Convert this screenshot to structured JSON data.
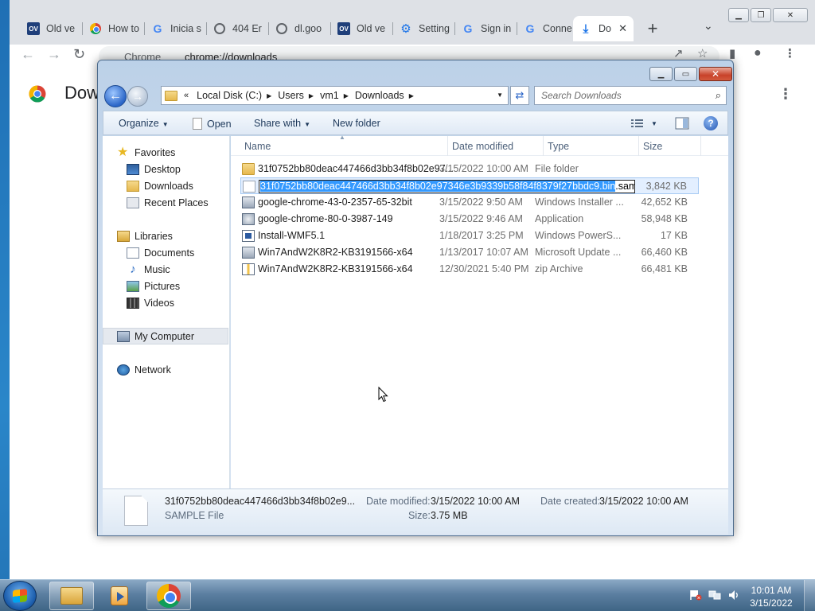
{
  "browser": {
    "tabs": [
      {
        "title": "Old ve",
        "icon": "ov-favicon"
      },
      {
        "title": "How to",
        "icon": "chrome-favicon"
      },
      {
        "title": "Inicia s",
        "icon": "google-favicon"
      },
      {
        "title": "404 Er",
        "icon": "globe-favicon"
      },
      {
        "title": "dl.goo",
        "icon": "globe-favicon"
      },
      {
        "title": "Old ve",
        "icon": "ov-favicon"
      },
      {
        "title": "Setting",
        "icon": "gear-favicon"
      },
      {
        "title": "Sign in",
        "icon": "google-favicon"
      },
      {
        "title": "Conne",
        "icon": "google-favicon"
      },
      {
        "title": "Do",
        "icon": "download-favicon",
        "active": true
      }
    ],
    "omnibox": {
      "site_label": "Chrome",
      "url": "chrome://downloads"
    },
    "page_title": "Dow"
  },
  "explorer": {
    "breadcrumb": [
      "Local Disk (C:)",
      "Users",
      "vm1",
      "Downloads"
    ],
    "search_placeholder": "Search Downloads",
    "commands": {
      "organize": "Organize",
      "open": "Open",
      "share_with": "Share with",
      "new_folder": "New folder"
    },
    "nav": {
      "favorites": "Favorites",
      "desktop": "Desktop",
      "downloads": "Downloads",
      "recent_places": "Recent Places",
      "libraries": "Libraries",
      "documents": "Documents",
      "music": "Music",
      "pictures": "Pictures",
      "videos": "Videos",
      "my_computer": "My Computer",
      "network": "Network"
    },
    "columns": {
      "name": "Name",
      "date": "Date modified",
      "type": "Type",
      "size": "Size"
    },
    "files": [
      {
        "name": "31f0752bb80deac447466d3bb34f8b02e97...",
        "date": "3/15/2022 10:00 AM",
        "type": "File folder",
        "size": "",
        "icon": "folder-icon"
      },
      {
        "name": "",
        "date": "",
        "type": "",
        "size": "3,842 KB",
        "icon": "file-icon",
        "renaming": true
      },
      {
        "name": "google-chrome-43-0-2357-65-32bit",
        "date": "3/15/2022 9:50 AM",
        "type": "Windows Installer ...",
        "size": "42,652 KB",
        "icon": "msi-icon"
      },
      {
        "name": "google-chrome-80-0-3987-149",
        "date": "3/15/2022 9:46 AM",
        "type": "Application",
        "size": "58,948 KB",
        "icon": "exe-icon"
      },
      {
        "name": "Install-WMF5.1",
        "date": "1/18/2017 3:25 PM",
        "type": "Windows PowerS...",
        "size": "17 KB",
        "icon": "powershell-icon"
      },
      {
        "name": "Win7AndW2K8R2-KB3191566-x64",
        "date": "1/13/2017 10:07 AM",
        "type": "Microsoft Update ...",
        "size": "66,460 KB",
        "icon": "msu-icon"
      },
      {
        "name": "Win7AndW2K8R2-KB3191566-x64",
        "date": "12/30/2021 5:40 PM",
        "type": "zip Archive",
        "size": "66,481 KB",
        "icon": "zip-icon"
      }
    ],
    "rename": {
      "selected": "31f0752bb80deac447466d3bb34f8b02e97346e3b9339b58f84f8379f27bbdc9.bin",
      "rest": ".sample"
    },
    "details": {
      "name": "31f0752bb80deac447466d3bb34f8b02e9...",
      "type": "SAMPLE File",
      "modified_label": "Date modified:",
      "modified": "3/15/2022 10:00 AM",
      "created_label": "Date created:",
      "created": "3/15/2022 10:00 AM",
      "size_label": "Size:",
      "size": "3.75 MB"
    }
  },
  "taskbar": {
    "time": "10:01 AM",
    "date": "3/15/2022"
  }
}
